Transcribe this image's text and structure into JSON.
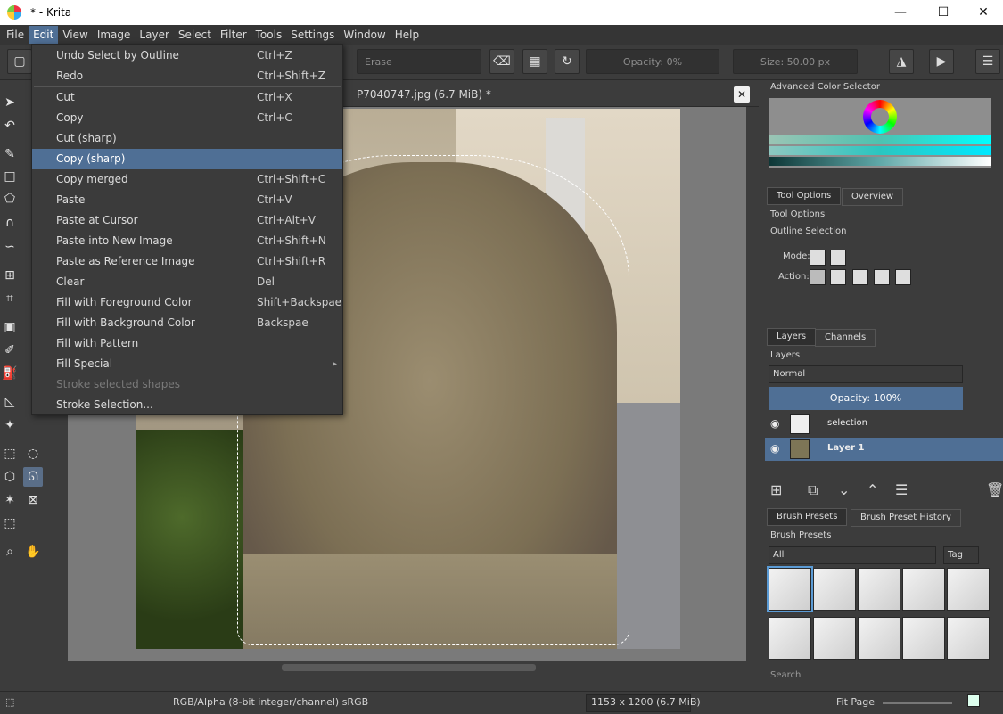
{
  "window": {
    "title": "* - Krita",
    "minimize": "—",
    "maximize": "☐",
    "close": "✕"
  },
  "menubar": [
    "File",
    "Edit",
    "View",
    "Image",
    "Layer",
    "Select",
    "Filter",
    "Tools",
    "Settings",
    "Window",
    "Help"
  ],
  "toolbar": {
    "blend_mode": "Erase",
    "opacity": "Opacity: 0%",
    "size": "Size: 50.00 px"
  },
  "document": {
    "tab_title": "P7040747.jpg (6.7 MiB) *",
    "close": "✕"
  },
  "edit_menu": [
    {
      "label": "Undo Select by Outline",
      "shortcut": "Ctrl+Z"
    },
    {
      "label": "Redo",
      "shortcut": "Ctrl+Shift+Z"
    },
    {
      "sep": true
    },
    {
      "label": "Cut",
      "shortcut": "Ctrl+X"
    },
    {
      "label": "Copy",
      "shortcut": "Ctrl+C"
    },
    {
      "label": "Cut (sharp)",
      "shortcut": ""
    },
    {
      "label": "Copy (sharp)",
      "shortcut": "",
      "highlighted": true
    },
    {
      "label": "Copy merged",
      "shortcut": "Ctrl+Shift+C"
    },
    {
      "label": "Paste",
      "shortcut": "Ctrl+V"
    },
    {
      "label": "Paste at Cursor",
      "shortcut": "Ctrl+Alt+V"
    },
    {
      "label": "Paste into New Image",
      "shortcut": "Ctrl+Shift+N"
    },
    {
      "label": "Paste as Reference Image",
      "shortcut": "Ctrl+Shift+R"
    },
    {
      "label": "Clear",
      "shortcut": "Del"
    },
    {
      "label": "Fill with Foreground Color",
      "shortcut": "Shift+Backspae"
    },
    {
      "label": "Fill with Background Color",
      "shortcut": "Backspae"
    },
    {
      "label": "Fill with Pattern",
      "shortcut": ""
    },
    {
      "label": "Fill Special",
      "shortcut": "",
      "submenu": true
    },
    {
      "label": "Stroke selected shapes",
      "shortcut": "",
      "disabled": true
    },
    {
      "label": "Stroke Selection...",
      "shortcut": ""
    }
  ],
  "dock": {
    "color_selector_title": "Advanced Color Selector",
    "tabs_tool": [
      "Tool Options",
      "Overview"
    ],
    "tool_options_title": "Tool Options",
    "tool_name": "Outline Selection",
    "mode_label": "Mode:",
    "action_label": "Action:",
    "tabs_layers": [
      "Layers",
      "Channels"
    ],
    "layers_title": "Layers",
    "blend_mode": "Normal",
    "opacity": "Opacity:  100%",
    "layers": [
      {
        "name": "selection",
        "selected": false
      },
      {
        "name": "Layer 1",
        "selected": true
      }
    ],
    "tabs_brush": [
      "Brush Presets",
      "Brush Preset History"
    ],
    "brush_title": "Brush Presets",
    "brush_filter": "All",
    "tag_label": "Tag",
    "search_placeholder": "Search"
  },
  "statusbar": {
    "color_model": "RGB/Alpha (8-bit integer/channel)  sRGB",
    "dimensions": "1153 x 1200 (6.7 MiB)",
    "zoom_mode": "Fit Page"
  }
}
